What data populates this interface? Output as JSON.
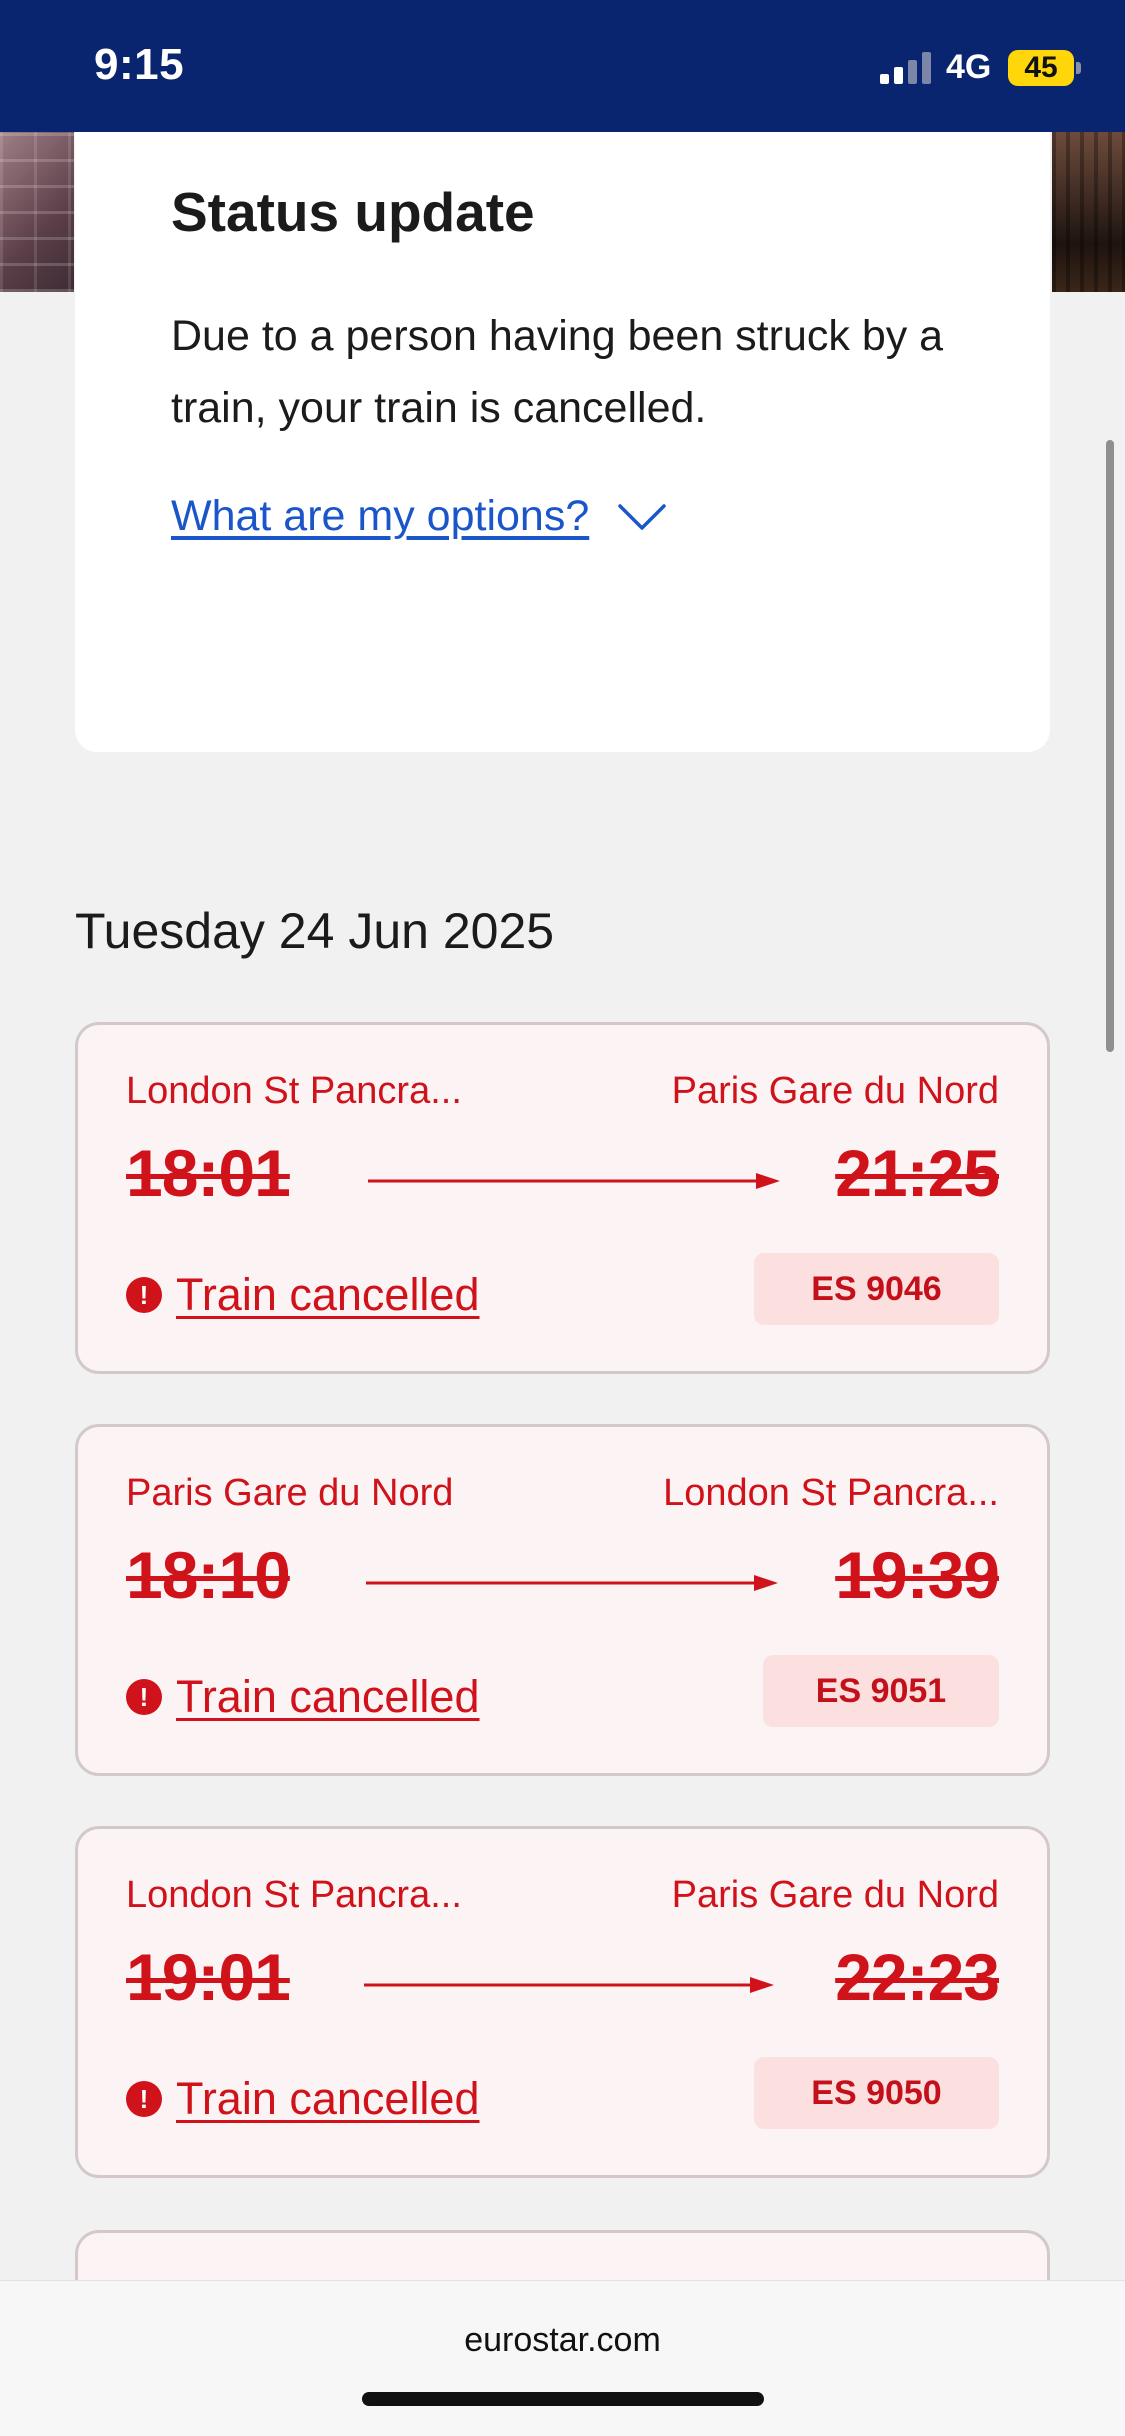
{
  "status_bar": {
    "time": "9:15",
    "network": "4G",
    "battery": "45"
  },
  "status_card": {
    "title": "Status update",
    "message": "Due to a person having been struck by a train, your train is cancelled.",
    "options_link": "What are my options?"
  },
  "date_heading": "Tuesday 24 Jun 2025",
  "journeys": [
    {
      "from": "London St Pancra...",
      "to": "Paris Gare du Nord",
      "departure": "18:01",
      "arrival": "21:25",
      "status": "Train cancelled",
      "train": "ES 9046"
    },
    {
      "from": "Paris Gare du Nord",
      "to": "London St Pancra...",
      "departure": "18:10",
      "arrival": "19:39",
      "status": "Train cancelled",
      "train": "ES 9051"
    },
    {
      "from": "London St Pancra...",
      "to": "Paris Gare du Nord",
      "departure": "19:01",
      "arrival": "22:23",
      "status": "Train cancelled",
      "train": "ES 9050"
    }
  ],
  "browser": {
    "domain": "eurostar.com"
  },
  "colors": {
    "header": "#0a2570",
    "cancelled": "#d0121b",
    "link": "#1a56c9",
    "battery": "#ffd60a"
  }
}
